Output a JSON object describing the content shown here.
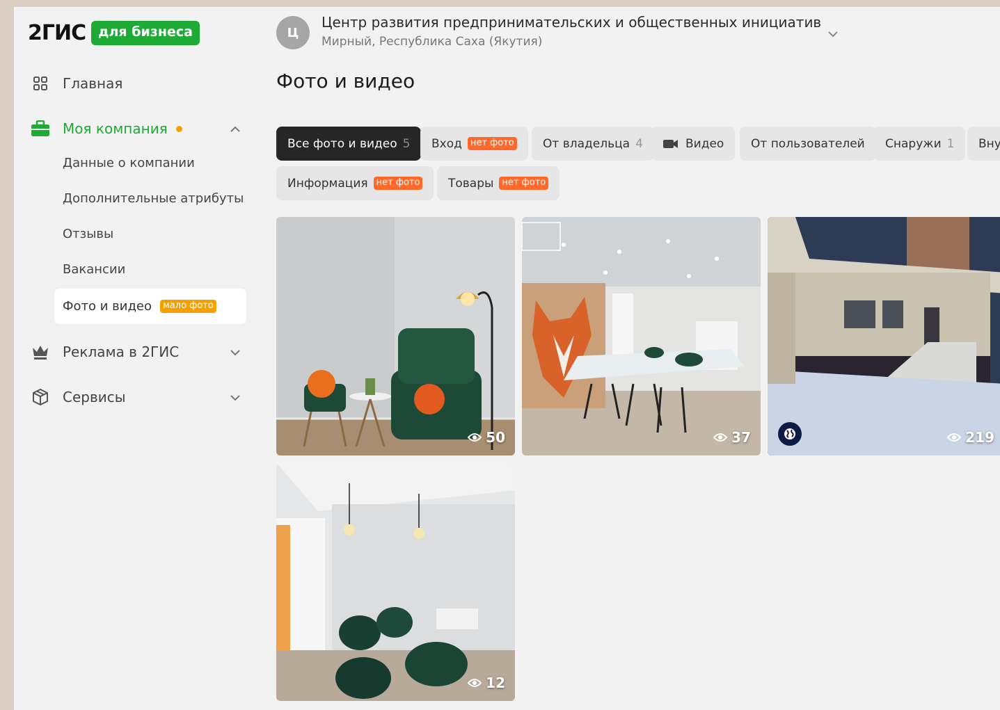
{
  "logo": {
    "main": "2ГИС",
    "badge": "для бизнеса"
  },
  "nav": {
    "home": "Главная",
    "company": "Моя компания",
    "company_sub": {
      "data": "Данные о компании",
      "attributes": "Дополнительные атрибуты",
      "reviews": "Отзывы",
      "vacancies": "Вакансии",
      "photos": "Фото и видео",
      "photos_badge": "мало фото"
    },
    "ads": "Реклама в 2ГИС",
    "services": "Сервисы"
  },
  "org": {
    "avatar_letter": "Ц",
    "name": "Центр развития предпринимательских и общественных инициатив",
    "city": "Мирный, Республика Саха (Якутия)"
  },
  "page": {
    "title": "Фото и видео"
  },
  "filters": [
    {
      "label": "Все фото и видео",
      "count": "5",
      "selected": true
    },
    {
      "label": "Вход",
      "badge": "нет фото"
    },
    {
      "label": "От владельца",
      "count": "4"
    },
    {
      "label": "Видео",
      "icon": "video-camera-icon"
    },
    {
      "label": "От пользователей"
    },
    {
      "label": "Снаружи",
      "count": "1"
    },
    {
      "label": "Вну"
    },
    {
      "label": "Информация",
      "badge": "нет фото"
    },
    {
      "label": "Товары",
      "badge": "нет фото"
    }
  ],
  "photos": [
    {
      "views": "50",
      "scene": "interior-armchair-lamp"
    },
    {
      "views": "37",
      "scene": "interior-fox-mural-table"
    },
    {
      "views": "219",
      "scene": "exterior-building-entrance",
      "badge_icon": "globe-icon"
    },
    {
      "views": "12",
      "scene": "interior-beanbags-lamps"
    }
  ],
  "colors": {
    "brand": "#1daa35",
    "warning": "#f4a100",
    "no_photo": "#ff6a2c",
    "selected_chip": "#262626"
  }
}
